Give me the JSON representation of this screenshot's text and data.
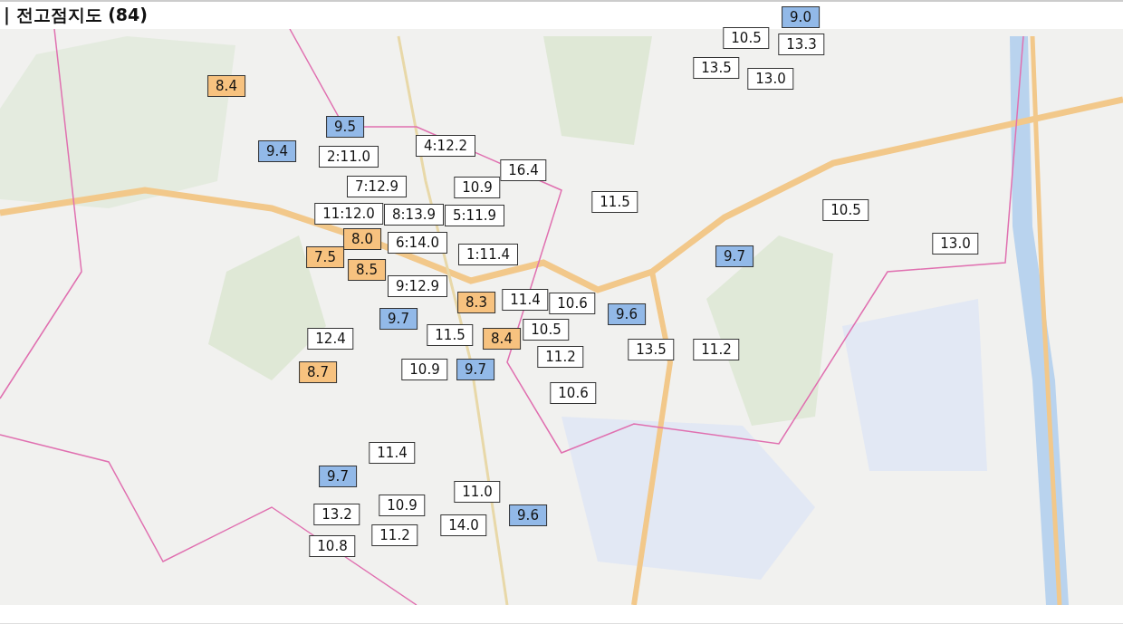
{
  "title": "| 전고점지도 (84)",
  "markers": [
    {
      "label": "8.4",
      "color": "#f7c27f"
    },
    {
      "label": "9.5",
      "color": "#92b9e8"
    },
    {
      "label": "9.4",
      "color": "#92b9e8"
    },
    {
      "label": "2:11.0",
      "color": "#ffffff"
    },
    {
      "label": "4:12.2",
      "color": "#ffffff"
    },
    {
      "label": "16.4",
      "color": "#ffffff"
    },
    {
      "label": "7:12.9",
      "color": "#ffffff"
    },
    {
      "label": "10.9",
      "color": "#ffffff"
    },
    {
      "label": "11:12.0",
      "color": "#ffffff"
    },
    {
      "label": "8:13.9",
      "color": "#ffffff"
    },
    {
      "label": "5:11.9",
      "color": "#ffffff"
    },
    {
      "label": "8.0",
      "color": "#f7c27f"
    },
    {
      "label": "7.5",
      "color": "#f7c27f"
    },
    {
      "label": "8.5",
      "color": "#f7c27f"
    },
    {
      "label": "6:14.0",
      "color": "#ffffff"
    },
    {
      "label": "1:11.4",
      "color": "#ffffff"
    },
    {
      "label": "9:12.9",
      "color": "#ffffff"
    },
    {
      "label": "8.3",
      "color": "#f7c27f"
    },
    {
      "label": "11.4",
      "color": "#ffffff"
    },
    {
      "label": "10.6",
      "color": "#ffffff"
    },
    {
      "label": "9.7",
      "color": "#92b9e8"
    },
    {
      "label": "9.6",
      "color": "#92b9e8"
    },
    {
      "label": "12.4",
      "color": "#ffffff"
    },
    {
      "label": "11.5",
      "color": "#ffffff"
    },
    {
      "label": "8.4",
      "color": "#f7c27f"
    },
    {
      "label": "10.5",
      "color": "#ffffff"
    },
    {
      "label": "11.2",
      "color": "#ffffff"
    },
    {
      "label": "13.5",
      "color": "#ffffff"
    },
    {
      "label": "11.2",
      "color": "#ffffff"
    },
    {
      "label": "8.7",
      "color": "#f7c27f"
    },
    {
      "label": "10.9",
      "color": "#ffffff"
    },
    {
      "label": "9.7",
      "color": "#92b9e8"
    },
    {
      "label": "10.6",
      "color": "#ffffff"
    },
    {
      "label": "11.5",
      "color": "#ffffff"
    },
    {
      "label": "10.5",
      "color": "#ffffff"
    },
    {
      "label": "9.7",
      "color": "#92b9e8"
    },
    {
      "label": "13.0",
      "color": "#ffffff"
    },
    {
      "label": "10.5",
      "color": "#ffffff"
    },
    {
      "label": "9.0",
      "color": "#92b9e8"
    },
    {
      "label": "13.3",
      "color": "#ffffff"
    },
    {
      "label": "13.5",
      "color": "#ffffff"
    },
    {
      "label": "13.0",
      "color": "#ffffff"
    },
    {
      "label": "11.4",
      "color": "#ffffff"
    },
    {
      "label": "9.7",
      "color": "#92b9e8"
    },
    {
      "label": "11.0",
      "color": "#ffffff"
    },
    {
      "label": "10.9",
      "color": "#ffffff"
    },
    {
      "label": "13.2",
      "color": "#ffffff"
    },
    {
      "label": "9.6",
      "color": "#92b9e8"
    },
    {
      "label": "14.0",
      "color": "#ffffff"
    },
    {
      "label": "11.2",
      "color": "#ffffff"
    },
    {
      "label": "10.8",
      "color": "#ffffff"
    }
  ]
}
